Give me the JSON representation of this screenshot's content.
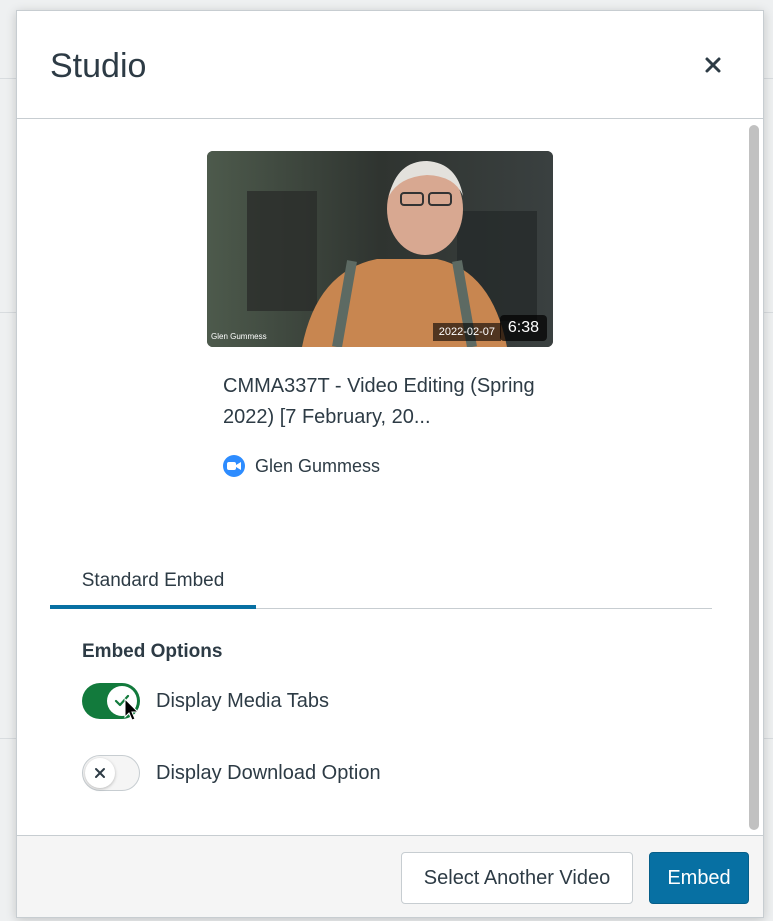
{
  "modal": {
    "title": "Studio",
    "close_icon": "close-icon"
  },
  "video": {
    "duration": "6:38",
    "date_overlay": "2022-02-07",
    "camera_name": "Glen Gummess",
    "title": "CMMA337T - Video Editing (Spring 2022) [7 February, 20...",
    "owner_icon": "zoom-icon",
    "owner_name": "Glen Gummess"
  },
  "tabs": [
    {
      "label": "Standard Embed",
      "active": true
    }
  ],
  "embed_options": {
    "heading": "Embed Options",
    "toggles": [
      {
        "label": "Display Media Tabs",
        "checked": true
      },
      {
        "label": "Display Download Option",
        "checked": false
      }
    ]
  },
  "footer": {
    "select_another_label": "Select Another Video",
    "embed_label": "Embed"
  },
  "colors": {
    "primary": "#0770a3",
    "toggle_on": "#127a3c",
    "zoom_blue": "#2d8cff"
  }
}
